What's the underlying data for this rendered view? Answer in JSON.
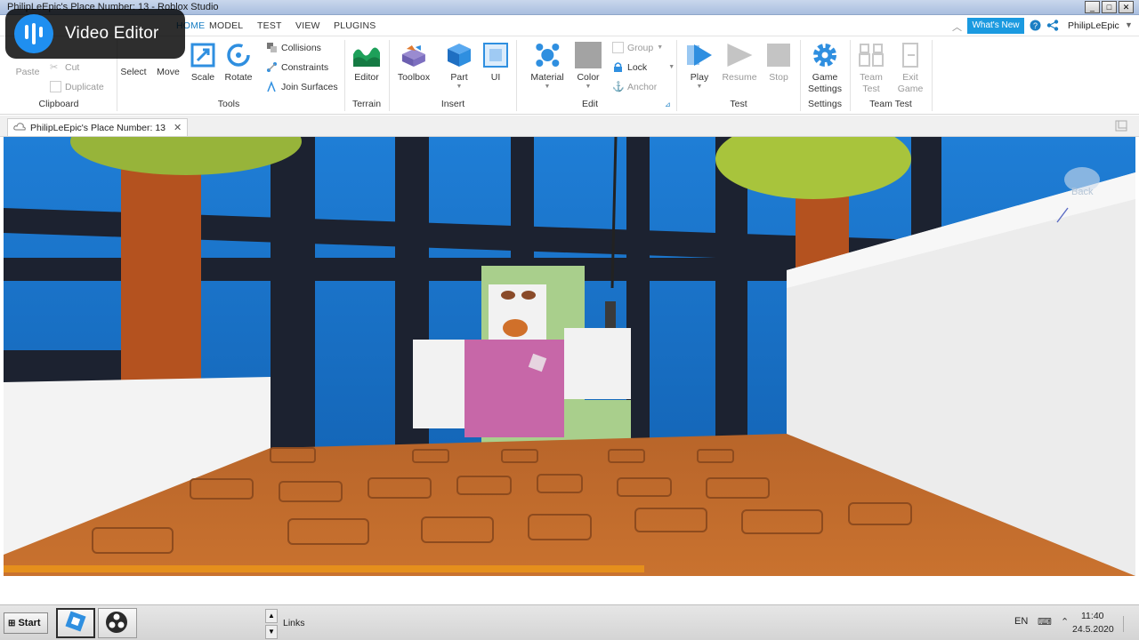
{
  "overlay": {
    "title": "Video Editor",
    "icon": "video-editor-app-icon"
  },
  "window": {
    "title": "PhilipLeEpic's Place Number: 13 - Roblox Studio",
    "controls": [
      "_",
      "□",
      "✕"
    ]
  },
  "menu": {
    "tabs": [
      "HOME",
      "MODEL",
      "TEST",
      "VIEW",
      "PLUGINS"
    ],
    "whats_new": "What's New",
    "user": "PhilipLeEpic"
  },
  "ribbon": {
    "clipboard": {
      "paste": "Paste",
      "cut": "Cut",
      "duplicate": "Duplicate",
      "label": "Clipboard"
    },
    "tools": {
      "select": "Select",
      "move": "Move",
      "scale": "Scale",
      "rotate": "Rotate",
      "collisions": "Collisions",
      "constraints": "Constraints",
      "join_surfaces": "Join Surfaces",
      "label": "Tools"
    },
    "terrain": {
      "editor": "Editor",
      "label": "Terrain"
    },
    "insert": {
      "toolbox": "Toolbox",
      "part": "Part",
      "ui": "UI",
      "label": "Insert"
    },
    "edit": {
      "material": "Material",
      "color": "Color",
      "group": "Group",
      "lock": "Lock",
      "anchor": "Anchor",
      "label": "Edit"
    },
    "test": {
      "play": "Play",
      "resume": "Resume",
      "stop": "Stop",
      "label": "Test"
    },
    "settings": {
      "game_settings_1": "Game",
      "game_settings_2": "Settings",
      "label": "Settings"
    },
    "team_test": {
      "team_test_1": "Team",
      "team_test_2": "Test",
      "exit_game_1": "Exit",
      "exit_game_2": "Game",
      "label": "Team Test"
    }
  },
  "document": {
    "tab_title": "PhilipLeEpic's Place Number: 13"
  },
  "viewport": {
    "back_label": "Back"
  },
  "taskbar": {
    "start": "Start",
    "links": "Links",
    "language": "EN",
    "time": "11:40",
    "date": "24.5.2020"
  }
}
